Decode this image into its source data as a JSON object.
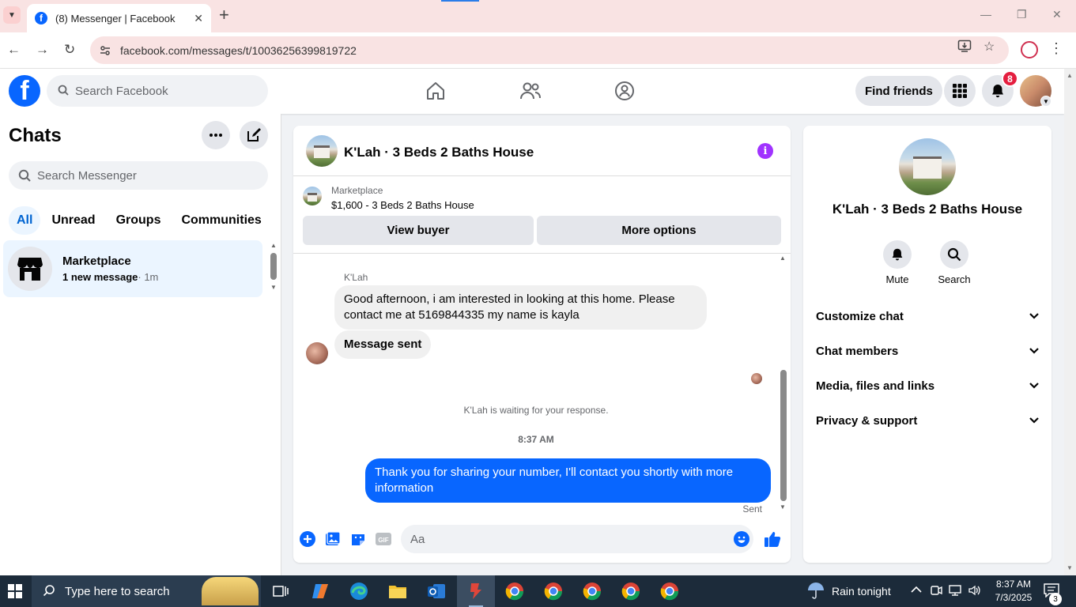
{
  "browser": {
    "tab_title": "(8) Messenger | Facebook",
    "url": "facebook.com/messages/t/10036256399819722",
    "tab_close": "✕",
    "new_tab": "+"
  },
  "fb": {
    "search_placeholder": "Search Facebook",
    "find_friends": "Find friends",
    "notification_count": "8"
  },
  "sidebar": {
    "title": "Chats",
    "search_placeholder": "Search Messenger",
    "filters": [
      "All",
      "Unread",
      "Groups",
      "Communities"
    ],
    "chats": [
      {
        "name": "Marketplace",
        "preview": "1 new message",
        "time": "· 1m"
      }
    ]
  },
  "conversation": {
    "title": "K'Lah · 3 Beds 2 Baths House",
    "marketplace_label": "Marketplace",
    "listing": "$1,600 - 3 Beds 2 Baths House",
    "view_buyer": "View buyer",
    "more_options": "More options",
    "sender": "K'Lah",
    "incoming_message": "Good afternoon, i am interested in looking at this home. Please contact me at 5169844335 my name is kayla",
    "auto_reply": "Message sent",
    "waiting_note": "K'Lah is waiting for your response.",
    "timestamp": "8:37 AM",
    "outgoing_message": "Thank you for sharing your number, I'll contact you shortly with more information",
    "status": "Sent",
    "composer_placeholder": "Aa",
    "gif_label": "GIF"
  },
  "info_panel": {
    "name": "K'Lah · 3 Beds 2 Baths House",
    "actions": [
      "Mute",
      "Search"
    ],
    "sections": [
      "Customize chat",
      "Chat members",
      "Media, files and links",
      "Privacy & support"
    ]
  },
  "taskbar": {
    "search_placeholder": "Type here to search",
    "weather": "Rain tonight",
    "time": "8:37 AM",
    "date": "7/3/2025",
    "notification_count": "3"
  },
  "colors": {
    "fb_blue": "#0866ff",
    "info_purple": "#a033ff",
    "selected_chat_bg": "#ebf5ff",
    "badge_red": "#e41e3f"
  }
}
